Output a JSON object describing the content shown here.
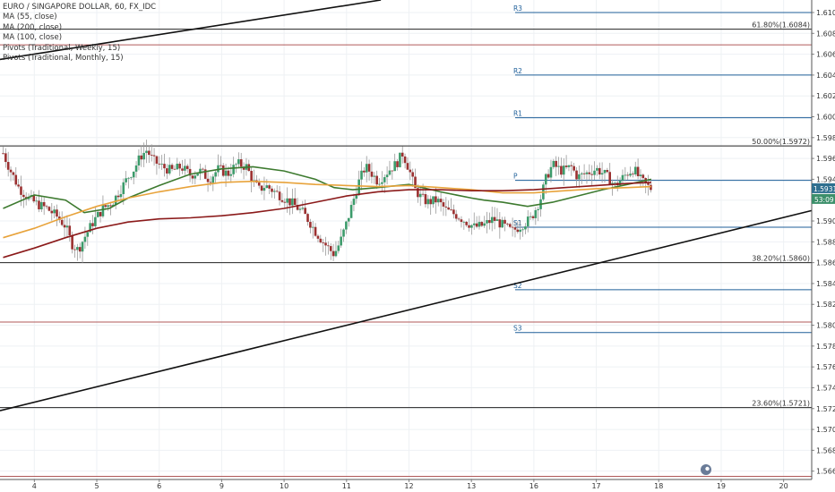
{
  "legend": {
    "symbol": "EURO / SINGAPORE DOLLAR, 60, FX_IDC",
    "indicators": [
      "MA (55, close)",
      "MA (200, close)",
      "MA (100, close)",
      "Pivots (Traditional, Weekly, 15)",
      "Pivots (Traditional, Monthly, 15)"
    ]
  },
  "colors": {
    "up": "#3c9b6b",
    "down": "#9b3030",
    "ma55": "#3d7a2f",
    "ma100": "#e8a33b",
    "ma200": "#8b1a1a",
    "pivot": "#1f5f99",
    "monthly_pivot": "#b05a5a",
    "fib": "#222222",
    "last_price_bg": "#2f6f8f",
    "countdown_bg": "#3c8f6b"
  },
  "chart_data": {
    "type": "candlestick",
    "title": "EURO / SINGAPORE DOLLAR, 60, FX_IDC",
    "ylim": [
      1.5652,
      1.6112
    ],
    "y_ticks": [
      "1.6100",
      "1.6080",
      "1.6060",
      "1.6040",
      "1.6020",
      "1.6000",
      "1.5980",
      "1.5960",
      "1.5940",
      "1.5920",
      "1.5900",
      "1.5880",
      "1.5860",
      "1.5840",
      "1.5820",
      "1.5800",
      "1.5780",
      "1.5760",
      "1.5740",
      "1.5720",
      "1.5700",
      "1.5680",
      "1.5660"
    ],
    "x_ticks": [
      {
        "label": "4",
        "pos": 0.5
      },
      {
        "label": "5",
        "pos": 1.5
      },
      {
        "label": "6",
        "pos": 2.5
      },
      {
        "label": "9",
        "pos": 3.5
      },
      {
        "label": "10",
        "pos": 4.5
      },
      {
        "label": "11",
        "pos": 5.5
      },
      {
        "label": "12",
        "pos": 6.5
      },
      {
        "label": "13",
        "pos": 7.5
      },
      {
        "label": "16",
        "pos": 8.5
      },
      {
        "label": "17",
        "pos": 9.5
      },
      {
        "label": "18",
        "pos": 10.5
      },
      {
        "label": "19",
        "pos": 11.5
      },
      {
        "label": "20",
        "pos": 12.5
      }
    ],
    "price_path": [
      [
        0.0,
        1.5965
      ],
      [
        0.12,
        1.5948
      ],
      [
        0.25,
        1.5932
      ],
      [
        0.4,
        1.5922
      ],
      [
        0.55,
        1.5916
      ],
      [
        0.7,
        1.5912
      ],
      [
        0.85,
        1.5905
      ],
      [
        1.0,
        1.5895
      ],
      [
        1.1,
        1.5878
      ],
      [
        1.2,
        1.5872
      ],
      [
        1.3,
        1.5884
      ],
      [
        1.45,
        1.59
      ],
      [
        1.6,
        1.5912
      ],
      [
        1.75,
        1.5918
      ],
      [
        1.9,
        1.5932
      ],
      [
        2.0,
        1.5942
      ],
      [
        2.1,
        1.595
      ],
      [
        2.2,
        1.5962
      ],
      [
        2.3,
        1.5968
      ],
      [
        2.4,
        1.5958
      ],
      [
        2.55,
        1.5952
      ],
      [
        2.7,
        1.5948
      ],
      [
        2.85,
        1.5952
      ],
      [
        3.0,
        1.5944
      ],
      [
        3.15,
        1.5948
      ],
      [
        3.3,
        1.594
      ],
      [
        3.45,
        1.595
      ],
      [
        3.6,
        1.5945
      ],
      [
        3.75,
        1.5955
      ],
      [
        3.9,
        1.5952
      ],
      [
        4.0,
        1.5938
      ],
      [
        4.1,
        1.593
      ],
      [
        4.2,
        1.5934
      ],
      [
        4.35,
        1.5928
      ],
      [
        4.5,
        1.5922
      ],
      [
        4.65,
        1.5916
      ],
      [
        4.8,
        1.5908
      ],
      [
        4.9,
        1.59
      ],
      [
        5.0,
        1.589
      ],
      [
        5.15,
        1.5878
      ],
      [
        5.3,
        1.5868
      ],
      [
        5.4,
        1.588
      ],
      [
        5.5,
        1.5898
      ],
      [
        5.6,
        1.5918
      ],
      [
        5.7,
        1.5938
      ],
      [
        5.8,
        1.5952
      ],
      [
        5.9,
        1.5946
      ],
      [
        6.0,
        1.5938
      ],
      [
        6.1,
        1.5944
      ],
      [
        6.2,
        1.595
      ],
      [
        6.3,
        1.5955
      ],
      [
        6.4,
        1.5965
      ],
      [
        6.5,
        1.595
      ],
      [
        6.6,
        1.593
      ],
      [
        6.7,
        1.5922
      ],
      [
        6.8,
        1.5918
      ],
      [
        6.95,
        1.592
      ],
      [
        7.1,
        1.591
      ],
      [
        7.25,
        1.5906
      ],
      [
        7.4,
        1.59
      ],
      [
        7.55,
        1.5894
      ],
      [
        7.7,
        1.5896
      ],
      [
        7.85,
        1.5902
      ],
      [
        8.0,
        1.5896
      ],
      [
        8.15,
        1.589
      ],
      [
        8.3,
        1.5896
      ],
      [
        8.45,
        1.5902
      ],
      [
        8.6,
        1.592
      ],
      [
        8.7,
        1.5942
      ],
      [
        8.8,
        1.5954
      ],
      [
        8.95,
        1.5948
      ],
      [
        9.1,
        1.5952
      ],
      [
        9.2,
        1.5942
      ],
      [
        9.35,
        1.5946
      ],
      [
        9.5,
        1.595
      ],
      [
        9.65,
        1.5944
      ],
      [
        9.8,
        1.5934
      ],
      [
        9.9,
        1.594
      ],
      [
        10.0,
        1.5946
      ],
      [
        10.1,
        1.595
      ],
      [
        10.2,
        1.594
      ],
      [
        10.3,
        1.5934
      ],
      [
        10.38,
        1.5931
      ]
    ],
    "series": [
      {
        "name": "MA (55, close)",
        "points": [
          [
            0.0,
            1.5912
          ],
          [
            0.5,
            1.5925
          ],
          [
            1.0,
            1.592
          ],
          [
            1.3,
            1.5908
          ],
          [
            1.7,
            1.5912
          ],
          [
            2.0,
            1.5922
          ],
          [
            2.5,
            1.5934
          ],
          [
            3.0,
            1.5945
          ],
          [
            3.5,
            1.595
          ],
          [
            4.0,
            1.5952
          ],
          [
            4.5,
            1.5948
          ],
          [
            5.0,
            1.594
          ],
          [
            5.3,
            1.5932
          ],
          [
            5.6,
            1.593
          ],
          [
            6.0,
            1.5932
          ],
          [
            6.5,
            1.5935
          ],
          [
            7.0,
            1.5928
          ],
          [
            7.5,
            1.5922
          ],
          [
            7.7,
            1.592
          ],
          [
            8.0,
            1.5918
          ],
          [
            8.4,
            1.5914
          ],
          [
            8.8,
            1.5918
          ],
          [
            9.2,
            1.5924
          ],
          [
            9.6,
            1.593
          ],
          [
            10.0,
            1.5935
          ],
          [
            10.38,
            1.594
          ]
        ]
      },
      {
        "name": "MA (100, close)",
        "points": [
          [
            0.0,
            1.5884
          ],
          [
            0.5,
            1.5893
          ],
          [
            1.0,
            1.5904
          ],
          [
            1.5,
            1.5914
          ],
          [
            2.0,
            1.5922
          ],
          [
            2.5,
            1.5928
          ],
          [
            3.0,
            1.5933
          ],
          [
            3.5,
            1.5937
          ],
          [
            4.0,
            1.5938
          ],
          [
            4.5,
            1.5937
          ],
          [
            5.0,
            1.5935
          ],
          [
            5.5,
            1.5934
          ],
          [
            6.0,
            1.5933
          ],
          [
            6.5,
            1.5934
          ],
          [
            7.0,
            1.5932
          ],
          [
            7.5,
            1.593
          ],
          [
            8.0,
            1.5927
          ],
          [
            8.5,
            1.5927
          ],
          [
            9.0,
            1.5929
          ],
          [
            9.5,
            1.5931
          ],
          [
            10.0,
            1.5932
          ],
          [
            10.38,
            1.5933
          ]
        ]
      },
      {
        "name": "MA (200, close)",
        "points": [
          [
            0.0,
            1.5865
          ],
          [
            0.5,
            1.5874
          ],
          [
            1.0,
            1.5884
          ],
          [
            1.5,
            1.5893
          ],
          [
            2.0,
            1.5899
          ],
          [
            2.5,
            1.5902
          ],
          [
            3.0,
            1.5903
          ],
          [
            3.5,
            1.5905
          ],
          [
            4.0,
            1.5908
          ],
          [
            4.5,
            1.5912
          ],
          [
            5.0,
            1.5918
          ],
          [
            5.5,
            1.5924
          ],
          [
            6.0,
            1.5928
          ],
          [
            6.5,
            1.593
          ],
          [
            7.0,
            1.593
          ],
          [
            7.5,
            1.5929
          ],
          [
            8.0,
            1.5929
          ],
          [
            8.5,
            1.593
          ],
          [
            9.0,
            1.5932
          ],
          [
            9.5,
            1.5934
          ],
          [
            10.0,
            1.5936
          ],
          [
            10.38,
            1.5937
          ]
        ]
      }
    ],
    "trendlines": [
      {
        "from": [
          -0.05,
          1.6055
        ],
        "to": [
          6.05,
          1.6112
        ]
      },
      {
        "from": [
          -0.05,
          1.5718
        ],
        "to": [
          12.95,
          1.591
        ]
      }
    ],
    "fib_levels": [
      {
        "label": "61.80%(1.6084)",
        "value": 1.6084
      },
      {
        "label": "50.00%(1.5972)",
        "value": 1.5972
      },
      {
        "label": "38.20%(1.5860)",
        "value": 1.586
      },
      {
        "label": "23.60%(1.5721)",
        "value": 1.5721
      }
    ],
    "monthly_pivots": [
      1.6069,
      1.5803,
      1.5655
    ],
    "weekly_pivots": [
      {
        "label": "R3",
        "value": 1.61
      },
      {
        "label": "R2",
        "value": 1.604
      },
      {
        "label": "R1",
        "value": 1.5999
      },
      {
        "label": "P",
        "value": 1.5939
      },
      {
        "label": "S1",
        "value": 1.5894
      },
      {
        "label": "S2",
        "value": 1.5834
      },
      {
        "label": "S3",
        "value": 1.5793
      }
    ],
    "pivot_start": 8.2,
    "last_price": "1.5931",
    "countdown": "53:09"
  }
}
